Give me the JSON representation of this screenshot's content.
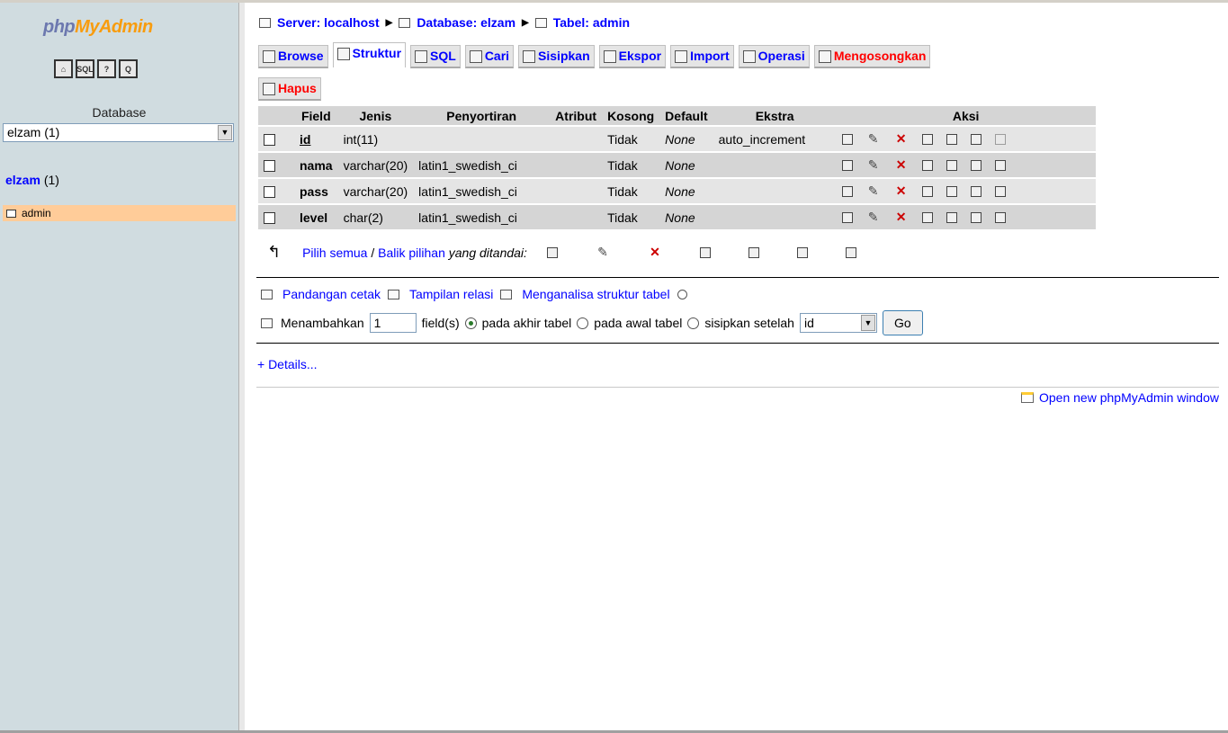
{
  "sidebar": {
    "logo": {
      "php": "php",
      "my": "My",
      "admin": "Admin"
    },
    "icons": [
      "home-icon",
      "sql-icon",
      "help-icon",
      "query-icon"
    ],
    "database_label": "Database",
    "database_select": "elzam (1)",
    "db_name": "elzam",
    "db_count": "(1)",
    "tables": [
      {
        "name": "admin"
      }
    ]
  },
  "breadcrumb": {
    "server": "Server: localhost",
    "database": "Database: elzam",
    "table": "Tabel: admin"
  },
  "tabs": [
    {
      "label": "Browse"
    },
    {
      "label": "Struktur"
    },
    {
      "label": "SQL"
    },
    {
      "label": "Cari"
    },
    {
      "label": "Sisipkan"
    },
    {
      "label": "Ekspor"
    },
    {
      "label": "Import"
    },
    {
      "label": "Operasi"
    },
    {
      "label": "Mengosongkan"
    },
    {
      "label": "Hapus"
    }
  ],
  "table": {
    "headers": [
      "Field",
      "Jenis",
      "Penyortiran",
      "Atribut",
      "Kosong",
      "Default",
      "Ekstra",
      "Aksi"
    ],
    "rows": [
      {
        "field": "id",
        "type": "int(11)",
        "collation": "",
        "attribute": "",
        "null": "Tidak",
        "default": "None",
        "extra": "auto_increment"
      },
      {
        "field": "nama",
        "type": "varchar(20)",
        "collation": "latin1_swedish_ci",
        "attribute": "",
        "null": "Tidak",
        "default": "None",
        "extra": ""
      },
      {
        "field": "pass",
        "type": "varchar(20)",
        "collation": "latin1_swedish_ci",
        "attribute": "",
        "null": "Tidak",
        "default": "None",
        "extra": ""
      },
      {
        "field": "level",
        "type": "char(2)",
        "collation": "latin1_swedish_ci",
        "attribute": "",
        "null": "Tidak",
        "default": "None",
        "extra": ""
      }
    ]
  },
  "with_selected": {
    "check_all": "Pilih semua",
    "slash": "/",
    "uncheck_all": "Balik pilihan",
    "label": "yang ditandai:"
  },
  "links": {
    "print_view": "Pandangan cetak",
    "relation_view": "Tampilan relasi",
    "analyze": "Menganalisa struktur tabel"
  },
  "add_fields": {
    "label": "Menambahkan",
    "count": "1",
    "fields_label": "field(s)",
    "at_end": "pada akhir tabel",
    "at_begin": "pada awal tabel",
    "after": "sisipkan setelah",
    "after_field": "id",
    "go": "Go"
  },
  "details": "+ Details...",
  "open_window": "Open new phpMyAdmin window",
  "colors": {
    "sidebar_bg": "#d0dce0",
    "highlight": "#ffcc99",
    "link": "#0000ff",
    "row_odd": "#e5e5e5",
    "row_even": "#d5d5d5"
  }
}
